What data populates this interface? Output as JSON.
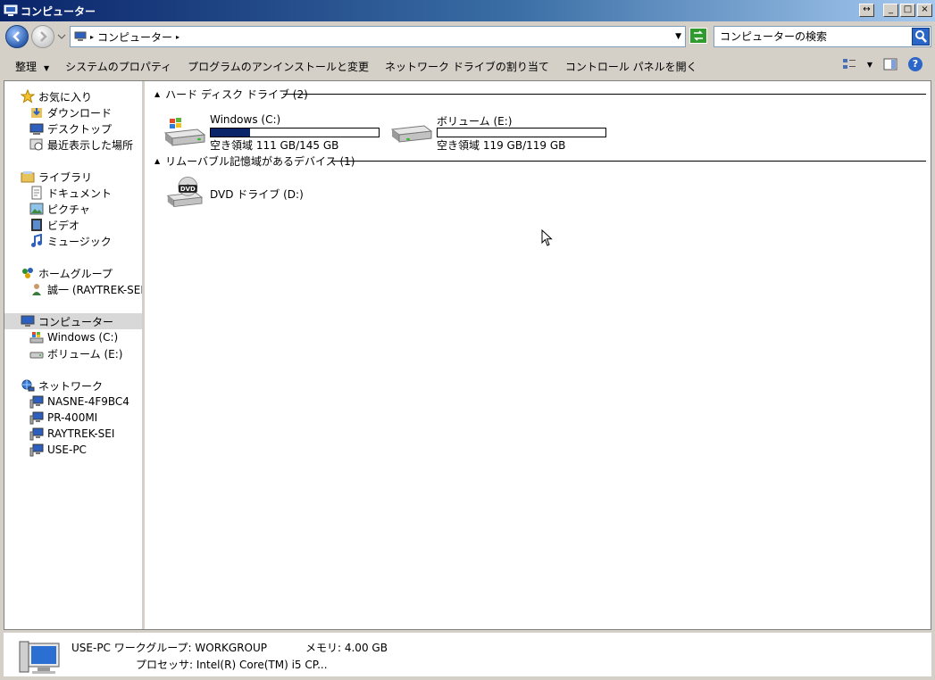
{
  "window": {
    "title": "コンピューター"
  },
  "title_buttons": {
    "restore_alt": "↔",
    "minimize": "_",
    "maximize": "□",
    "close": "×"
  },
  "address": {
    "crumb": "コンピューター"
  },
  "search": {
    "placeholder": "コンピューターの検索"
  },
  "toolbar": {
    "organize": "整理",
    "system_properties": "システムのプロパティ",
    "uninstall": "プログラムのアンインストールと変更",
    "map_drive": "ネットワーク ドライブの割り当て",
    "control_panel": "コントロール パネルを開く"
  },
  "nav": {
    "favorites": {
      "label": "お気に入り",
      "items": [
        "ダウンロード",
        "デスクトップ",
        "最近表示した場所"
      ]
    },
    "libraries": {
      "label": "ライブラリ",
      "items": [
        "ドキュメント",
        "ピクチャ",
        "ビデオ",
        "ミュージック"
      ]
    },
    "homegroup": {
      "label": "ホームグループ",
      "items": [
        "誠一 (RAYTREK-SEI"
      ]
    },
    "computer": {
      "label": "コンピューター",
      "items": [
        "Windows (C:)",
        "ボリューム (E:)"
      ]
    },
    "network": {
      "label": "ネットワーク",
      "items": [
        "NASNE-4F9BC4",
        "PR-400MI",
        "RAYTREK-SEI",
        "USE-PC"
      ]
    }
  },
  "groups": {
    "hard_disks": "ハード ディスク ドライブ (2)",
    "removable": "リムーバブル記憶域があるデバイス (1)"
  },
  "drives": [
    {
      "name": "Windows (C:)",
      "free": "空き領域 111 GB/145 GB",
      "used_fraction": 0.234
    },
    {
      "name": "ボリューム (E:)",
      "free": "空き領域 119 GB/119 GB",
      "used_fraction": 0.0
    },
    {
      "name": "DVD ドライブ (D:)"
    }
  ],
  "details": {
    "line1": "USE-PC ワークグループ: WORKGROUP",
    "memory": "メモリ: 4.00 GB",
    "processor": "プロセッサ: Intel(R) Core(TM) i5 CP..."
  },
  "colors": {
    "titlebar_start": "#0a246a",
    "titlebar_end": "#a6caf0",
    "usage_fill": "#0a246a",
    "face": "#d4d0c8"
  }
}
